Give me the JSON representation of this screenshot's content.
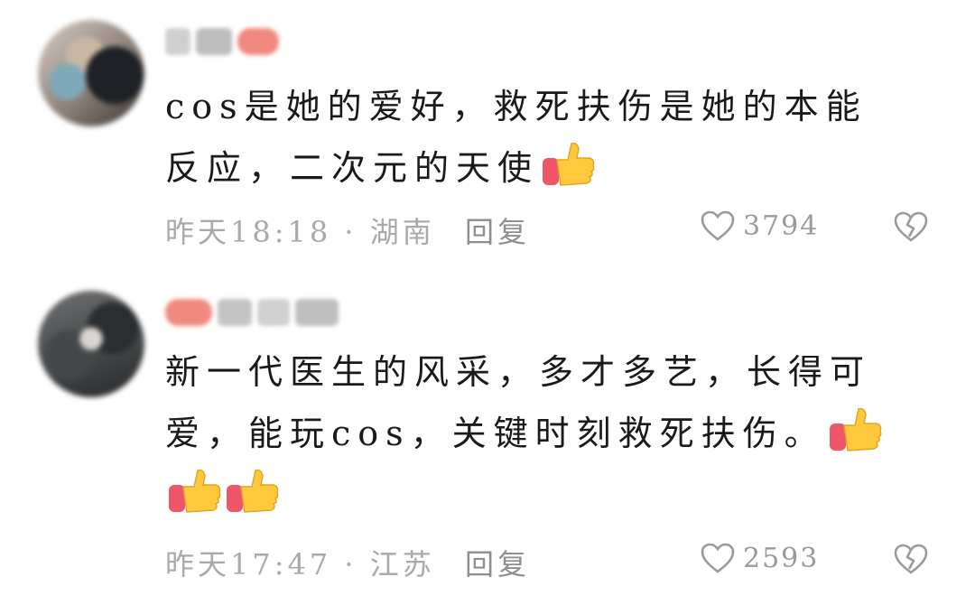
{
  "comments": [
    {
      "text": "cos是她的爱好，救死扶伤是她的本能反应，二次元的天使",
      "thumbs_count": 1,
      "time": "昨天18:18",
      "location": "湖南",
      "reply_label": "回复",
      "likes": "3794",
      "avatar_colors": [
        "#8d8078",
        "#7fa9b9"
      ],
      "name_colors": [
        "#cfcfcf",
        "#bdbdbd",
        "#f08a80"
      ]
    },
    {
      "text": "新一代医生的风采，多才多艺，长得可爱，能玩cos，关键时刻救死扶伤。",
      "thumbs_count": 3,
      "time": "昨天17:47",
      "location": "江苏",
      "reply_label": "回复",
      "likes": "2593",
      "avatar_colors": [
        "#262829",
        "#d9d6d2"
      ],
      "name_colors": [
        "#f08a80",
        "#c4c4c4",
        "#d0d0d0",
        "#bfbfbf"
      ]
    }
  ],
  "separator": " · ",
  "colors": {
    "meta_text": "#a9a9a9",
    "icon_stroke": "#9a9a9a",
    "thumb_yellow": "#ffc93c",
    "thumb_sleeve": "#f0566a"
  },
  "icons": {
    "like": "heart-outline-icon",
    "dislike": "broken-heart-icon",
    "emoji": "thumbs-up-emoji"
  }
}
